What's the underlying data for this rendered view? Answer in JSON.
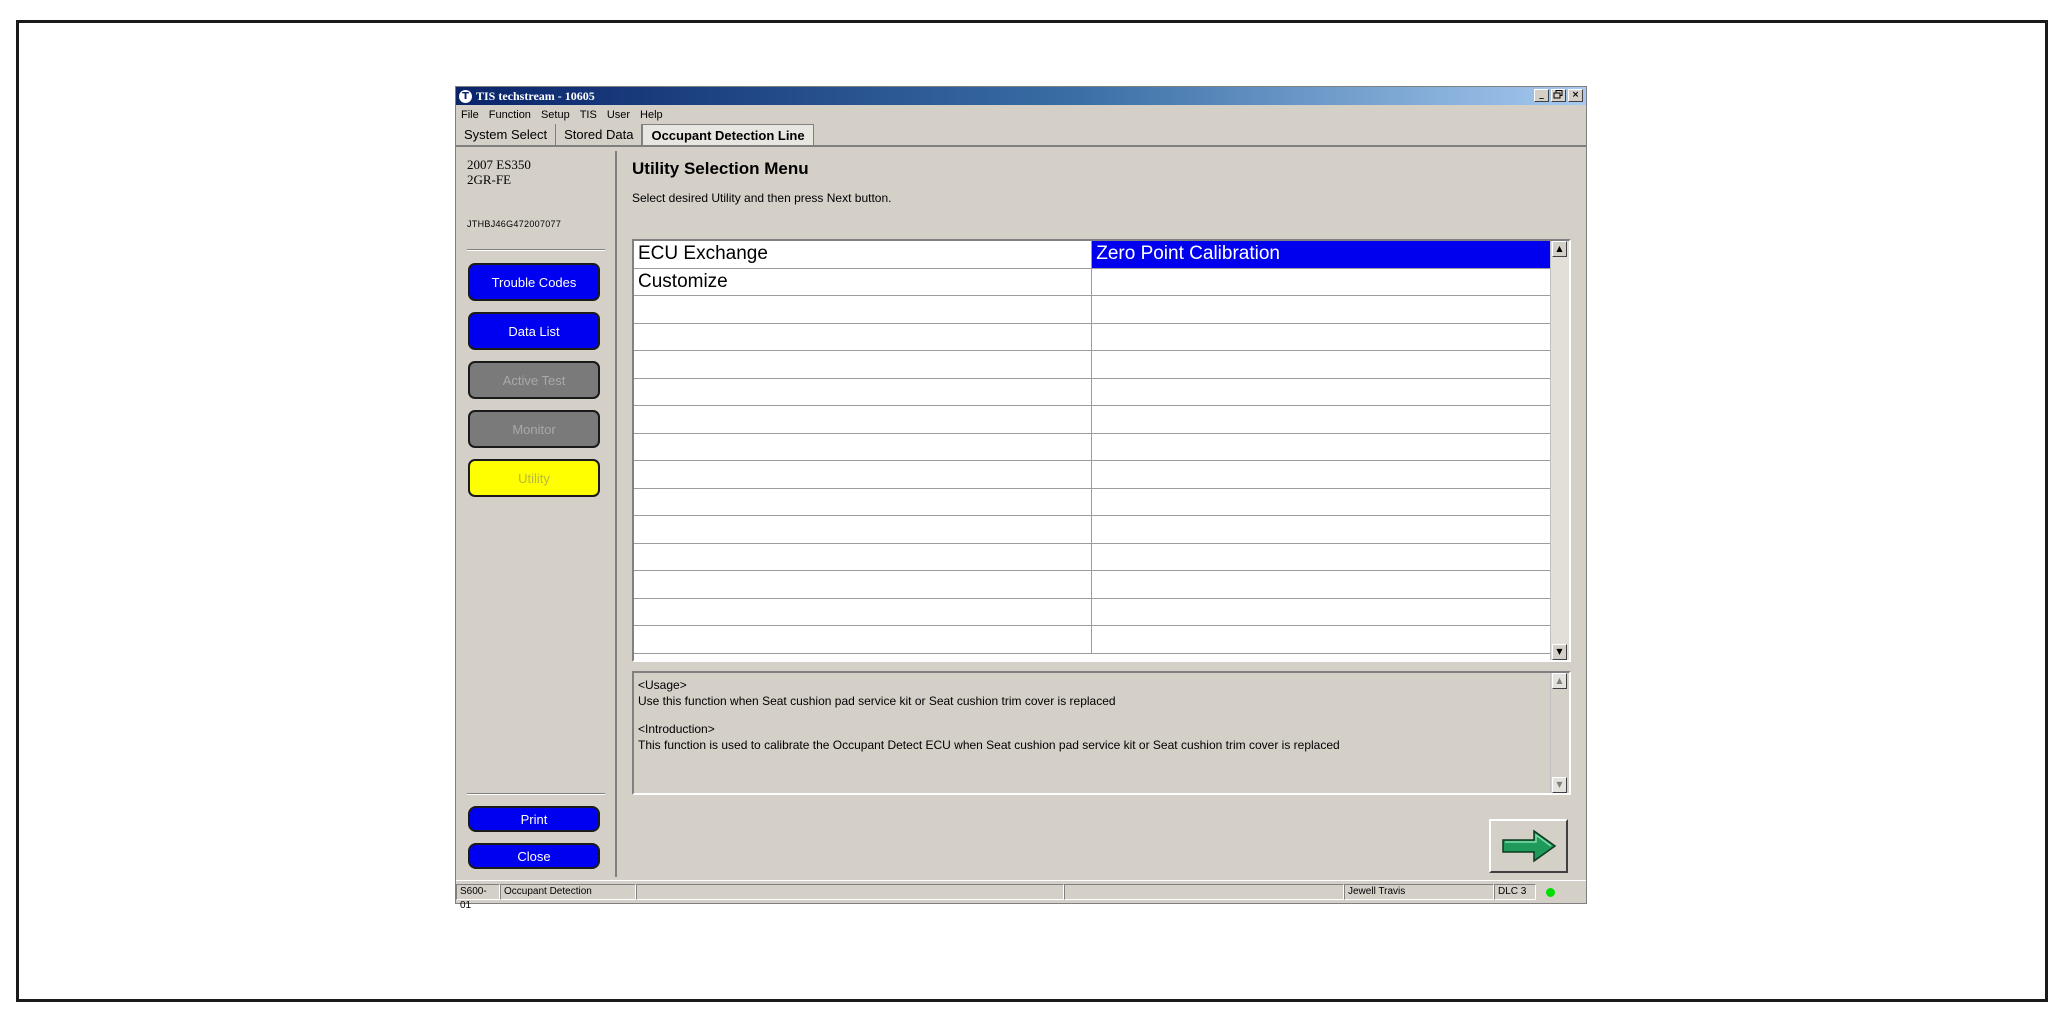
{
  "window": {
    "title": "TIS techstream - 10605",
    "controls": {
      "minimize": "_",
      "restore": "̸̣",
      "close": "×"
    }
  },
  "menubar": [
    "File",
    "Function",
    "Setup",
    "TIS",
    "User",
    "Help"
  ],
  "tabs": [
    {
      "label": "System Select",
      "active": false
    },
    {
      "label": "Stored Data",
      "active": false
    },
    {
      "label": "Occupant Detection Line",
      "active": true
    }
  ],
  "vehicle": {
    "model": "2007 ES350",
    "engine": "2GR-FE",
    "vin": "JTHBJ46G472007077"
  },
  "sidebar": {
    "buttons": [
      {
        "label": "Trouble Codes",
        "state": "enabled"
      },
      {
        "label": "Data List",
        "state": "enabled"
      },
      {
        "label": "Active Test",
        "state": "disabled"
      },
      {
        "label": "Monitor",
        "state": "disabled"
      },
      {
        "label": "Utility",
        "state": "selected"
      }
    ],
    "bottom_buttons": [
      "Print",
      "Close"
    ]
  },
  "main": {
    "heading": "Utility Selection Menu",
    "instruction": "Select desired Utility and then press Next button.",
    "utilities": [
      [
        "ECU Exchange",
        "Zero Point Calibration"
      ],
      [
        "Customize",
        ""
      ]
    ],
    "selected_item": "Zero Point Calibration",
    "scroll_up": "▲",
    "scroll_down": "▼",
    "info": {
      "usage_header": "<Usage>",
      "usage_text": "Use this function when Seat cushion pad service kit or Seat cushion trim cover is replaced",
      "intro_header": "<Introduction>",
      "intro_text": "This function is used to calibrate the Occupant Detect ECU when Seat cushion pad service kit or Seat cushion trim cover is replaced"
    }
  },
  "statusbar": {
    "code": "S600-01",
    "system": "Occupant Detection",
    "user": "Jewell Travis",
    "connection": "DLC 3",
    "connection_color": "#00dd00"
  },
  "colors": {
    "selected_row": "#0000ee",
    "button_blue": "#0000f0",
    "button_gray": "#7a7a7a",
    "button_yellow": "#ffff00",
    "next_arrow": "#1f9a5a"
  }
}
